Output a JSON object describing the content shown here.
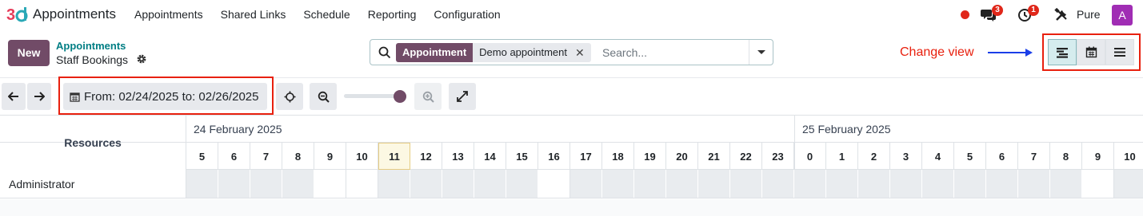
{
  "app": {
    "name": "Appointments",
    "logo_icon": "odoo-appointments-logo-icon",
    "menu": [
      "Appointments",
      "Shared Links",
      "Schedule",
      "Reporting",
      "Configuration"
    ]
  },
  "systray": {
    "recording_icon": "record-dot-icon",
    "messages_icon": "chat-bubbles-icon",
    "messages_count": "3",
    "activities_icon": "clock-activity-icon",
    "activities_count": "1",
    "tools_icon": "tools-icon",
    "company": "Pure",
    "avatar_initial": "A",
    "avatar_color": "#a02db4"
  },
  "control_panel": {
    "new_label": "New",
    "breadcrumb_parent": "Appointments",
    "breadcrumb_current": "Staff Bookings",
    "settings_icon": "gear-icon"
  },
  "search": {
    "facet_category": "Appointment",
    "facet_value": "Demo appointment",
    "facet_remove": "✕",
    "placeholder": "Search...",
    "icon": "search-icon"
  },
  "annotation": {
    "change_view_label": "Change view",
    "color": "#e8200e",
    "arrow_color": "#1a3ee8"
  },
  "views": [
    {
      "name": "gantt",
      "icon": "gantt-view-icon",
      "active": true
    },
    {
      "name": "calendar",
      "icon": "calendar-view-icon",
      "active": false
    },
    {
      "name": "list",
      "icon": "list-view-icon",
      "active": false
    }
  ],
  "gantt_toolbar": {
    "date_range": "From: 02/24/2025 to: 02/26/2025",
    "zoom_level": 0.9
  },
  "gantt": {
    "resources_label": "Resources",
    "days": [
      "24 February 2025",
      "25 February 2025"
    ],
    "hours_day1": [
      "5",
      "6",
      "7",
      "8",
      "9",
      "10",
      "11",
      "12",
      "13",
      "14",
      "15",
      "16",
      "17",
      "18",
      "19",
      "20",
      "21",
      "22",
      "23"
    ],
    "hours_day2": [
      "0",
      "1",
      "2",
      "3",
      "4",
      "5",
      "6",
      "7",
      "8",
      "9",
      "10"
    ],
    "today_hour": "11",
    "rows": [
      {
        "label": "Administrator",
        "free_cells": [
          4,
          5,
          11,
          28
        ]
      }
    ]
  },
  "colors": {
    "brand": "#714b67",
    "accent_teal": "#017e84",
    "badge_red": "#e0271a"
  }
}
